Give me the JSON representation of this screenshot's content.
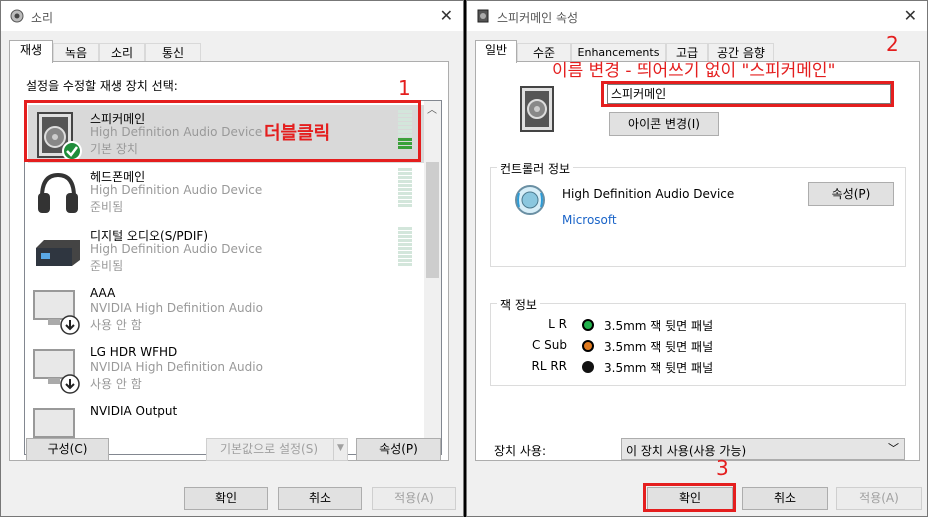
{
  "left_window": {
    "title": "소리",
    "tabs": [
      "재생",
      "녹음",
      "소리",
      "통신"
    ],
    "instruction": "설정을 수정할 재생 장치 선택:",
    "devices": [
      {
        "name": "스피커메인",
        "desc": "High Definition Audio Device",
        "status": "기본 장치"
      },
      {
        "name": "헤드폰메인",
        "desc": "High Definition Audio Device",
        "status": "준비됨"
      },
      {
        "name": "디지털 오디오(S/PDIF)",
        "desc": "High Definition Audio Device",
        "status": "준비됨"
      },
      {
        "name": "AAA",
        "desc": "NVIDIA High Definition Audio",
        "status": "사용 안 함"
      },
      {
        "name": "LG HDR WFHD",
        "desc": "NVIDIA High Definition Audio",
        "status": "사용 안 함"
      },
      {
        "name": "NVIDIA Output",
        "desc": "",
        "status": ""
      }
    ],
    "configure_label": "구성(C)",
    "set_default_label": "기본값으로 설정(S)",
    "properties_label": "속성(P)",
    "ok_label": "확인",
    "cancel_label": "취소",
    "apply_label": "적용(A)"
  },
  "right_window": {
    "title": "스피커메인 속성",
    "tabs": [
      "일반",
      "수준",
      "Enhancements",
      "고급",
      "공간 음향"
    ],
    "name_value": "스피커메인",
    "change_icon_label": "아이콘 변경(I)",
    "controller_group": "컨트롤러 정보",
    "controller_name": "High Definition Audio Device",
    "controller_vendor": "Microsoft",
    "properties_label": "속성(P)",
    "jack_group": "잭 정보",
    "jacks": [
      {
        "label": "L R",
        "desc": "3.5mm 잭 뒷면 패널",
        "color": "#22b14c"
      },
      {
        "label": "C Sub",
        "desc": "3.5mm 잭 뒷면 패널",
        "color": "#e07a1f"
      },
      {
        "label": "RL RR",
        "desc": "3.5mm 잭 뒷면 패널",
        "color": "#111111"
      }
    ],
    "device_usage_label": "장치 사용:",
    "device_usage_value": "이 장치 사용(사용 가능)",
    "ok_label": "확인",
    "cancel_label": "취소",
    "apply_label": "적용(A)"
  },
  "annotations": {
    "step1": "1",
    "step1_text": "더블클릭",
    "step2": "2",
    "step2_text": "이름 변경 - 띄어쓰기 없이 \"스피커메인\"",
    "step3": "3"
  },
  "colors": {
    "annotation": "#e41e1e",
    "selected_row": "#d9d9d9",
    "link_blue": "#1a64c8"
  }
}
